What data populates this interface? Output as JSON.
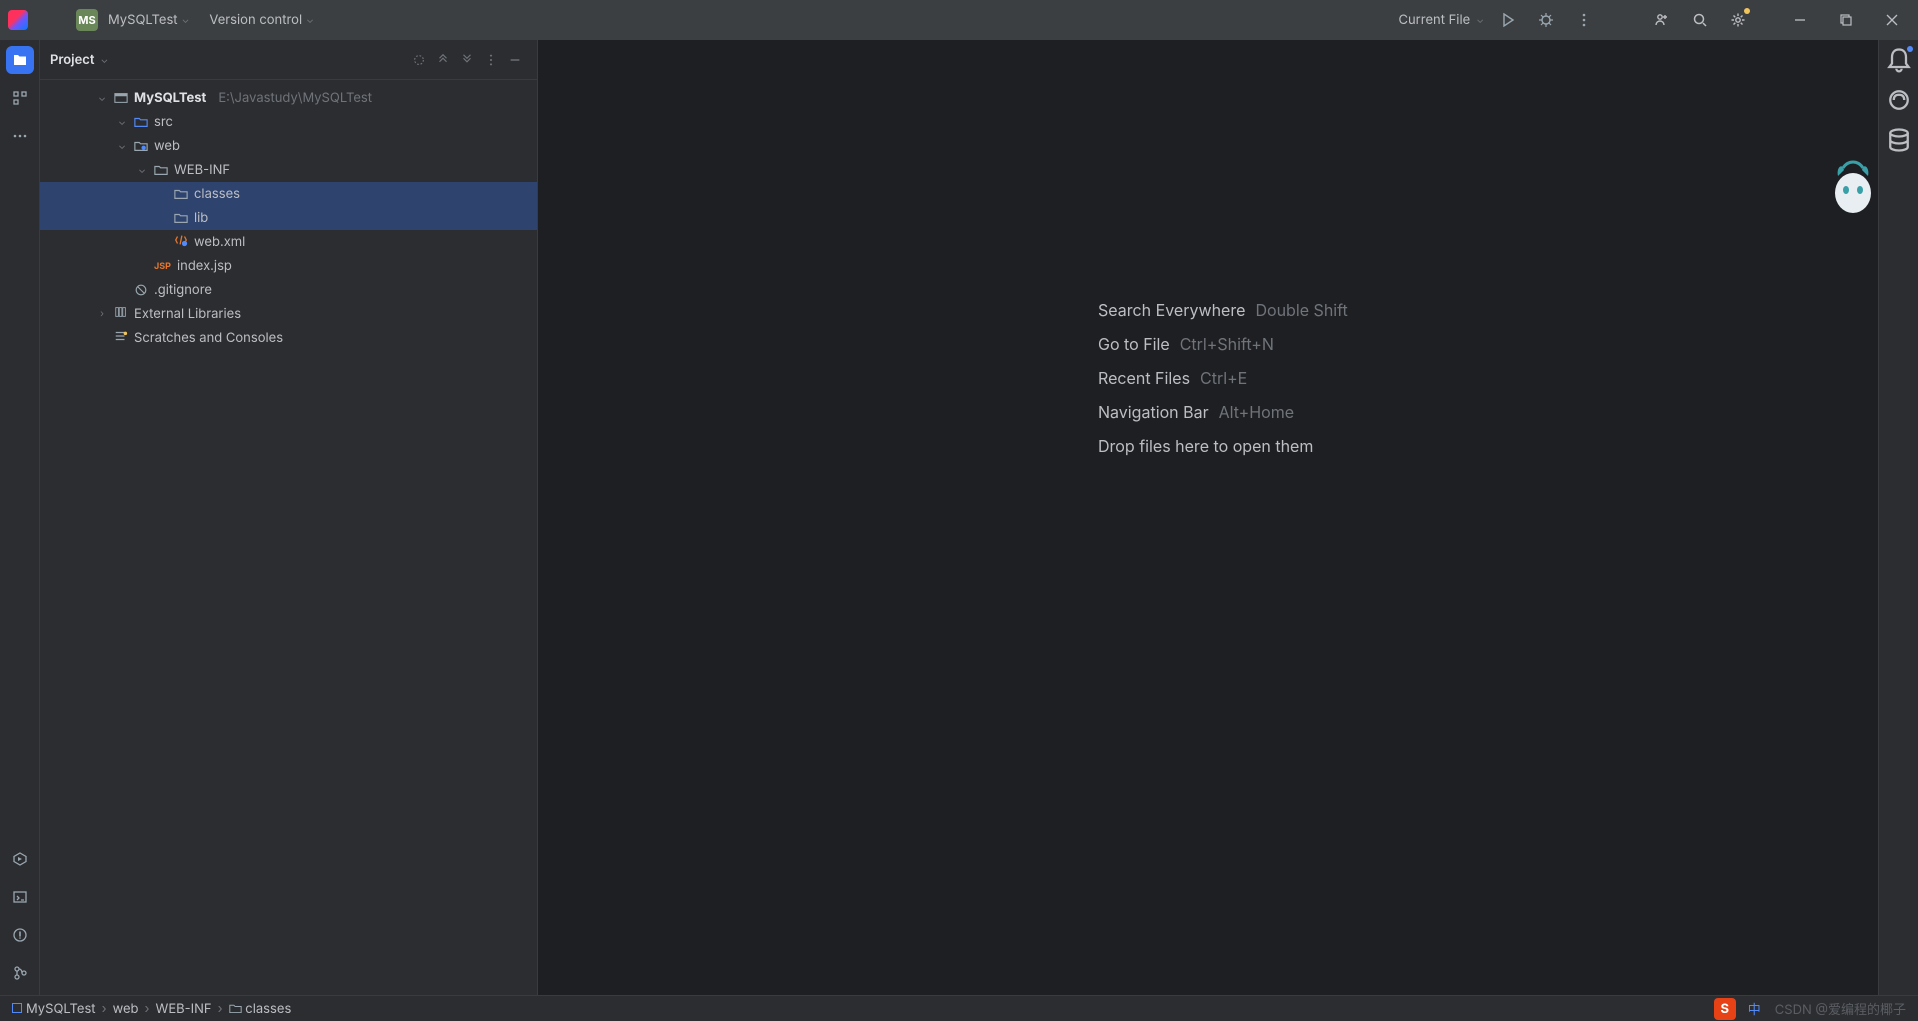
{
  "titlebar": {
    "project_badge": "MS",
    "project_name": "MySQLTest",
    "vcs_label": "Version control",
    "run_config": "Current File"
  },
  "project_panel": {
    "title": "Project"
  },
  "tree": {
    "root_name": "MySQLTest",
    "root_path": "E:\\Javastudy\\MySQLTest",
    "src": "src",
    "web": "web",
    "webinf": "WEB-INF",
    "classes": "classes",
    "lib": "lib",
    "webxml": "web.xml",
    "indexjsp": "index.jsp",
    "gitignore": ".gitignore",
    "ext_libs": "External Libraries",
    "scratches": "Scratches and Consoles"
  },
  "welcome": {
    "r1_act": "Search Everywhere",
    "r1_key": "Double Shift",
    "r2_act": "Go to File",
    "r2_key": "Ctrl+Shift+N",
    "r3_act": "Recent Files",
    "r3_key": "Ctrl+E",
    "r4_act": "Navigation Bar",
    "r4_key": "Alt+Home",
    "r5_act": "Drop files here to open them"
  },
  "breadcrumbs": {
    "b1": "MySQLTest",
    "b2": "web",
    "b3": "WEB-INF",
    "b4": "classes"
  },
  "watermark": "CSDN @爱编程的椰子",
  "ime_char": "S",
  "ime_lang": "中"
}
